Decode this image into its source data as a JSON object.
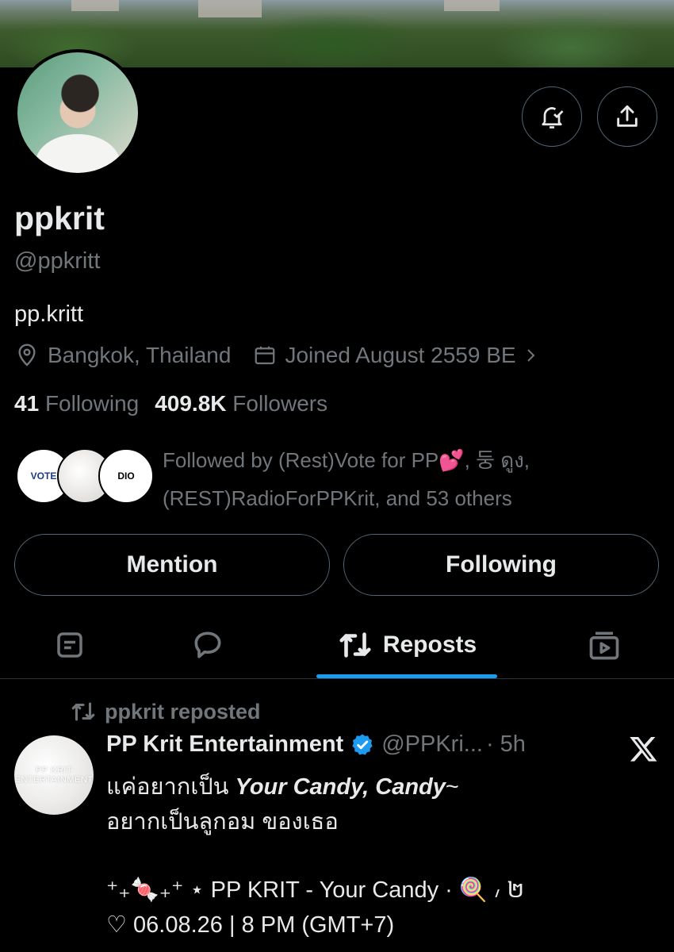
{
  "profile": {
    "name": "ppkrit",
    "handle": "@ppkritt",
    "bio": "pp.kritt",
    "location": "Bangkok, Thailand",
    "joined": "Joined August 2559 BE",
    "following_count": "41",
    "following_label": "Following",
    "followers_count": "409.8K",
    "followers_label": "Followers",
    "followed_by_line1": "Followed by (Rest)Vote for PP💕, 둥 ดูง,",
    "followed_by_line2": "(REST)RadioForPPKrit, and 53 others",
    "follower_avatar_1_text": "VOTE",
    "follower_avatar_3_text": "DIO"
  },
  "actions": {
    "mention_label": "Mention",
    "following_label": "Following"
  },
  "tabs": {
    "active_label": "Reposts",
    "items": [
      "posts-icon",
      "replies-icon",
      "reposts-icon",
      "media-icon"
    ]
  },
  "post": {
    "repost_label": "ppkrit reposted",
    "author_name": "PP Krit Entertainment",
    "author_handle": "@PPKri...",
    "time": "· 5h",
    "avatar_text": "PP KRIT ENTERTAINMENT",
    "line1_thai": "แค่อยากเป็น ",
    "line1_italic": "Your Candy, Candy",
    "line1_tail": "~",
    "line2": "อยากเป็นลูกอม ของเธอ",
    "line4": "⁺₊🍬₊⁺ ⋆ PP KRIT - Your Candy · 🍭 ៸ ២",
    "line5": "♡ 06.08.26 | 8 PM (GMT+7)"
  },
  "colors": {
    "background": "#000000",
    "text_primary": "#e7e9ea",
    "text_secondary": "#71767b",
    "border": "#536471",
    "accent": "#1d9bf0"
  }
}
